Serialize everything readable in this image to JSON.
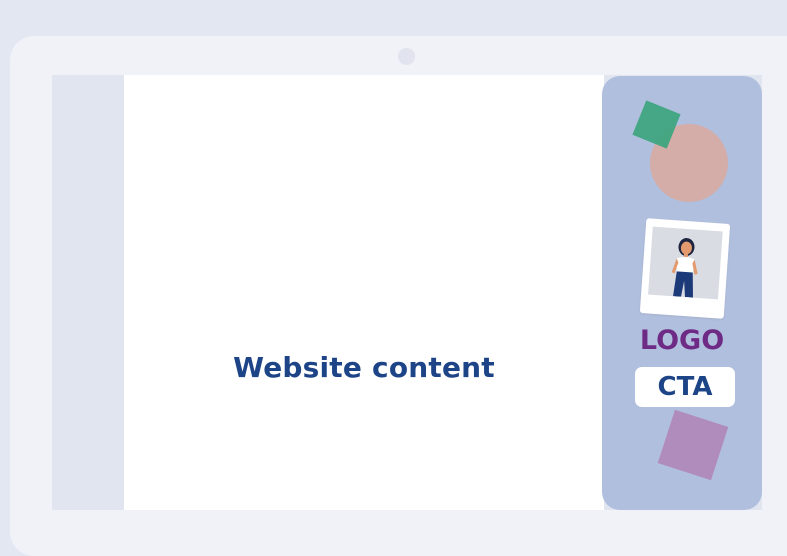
{
  "main": {
    "content_text": "Website content"
  },
  "sidebar": {
    "logo_text": "LOGO",
    "cta_label": "CTA"
  },
  "colors": {
    "background": "#e3e7f1",
    "device_frame": "#f0f2f7",
    "content_text": "#1d4487",
    "side_panel": "#b1bfde",
    "logo_text": "#6e2b86",
    "green_square": "#3fa57f",
    "peach_circle": "#d4aca8",
    "purple_square": "#b08cbd"
  },
  "icons": {
    "camera": "camera-dot-icon",
    "photo": "person-photo-icon"
  }
}
